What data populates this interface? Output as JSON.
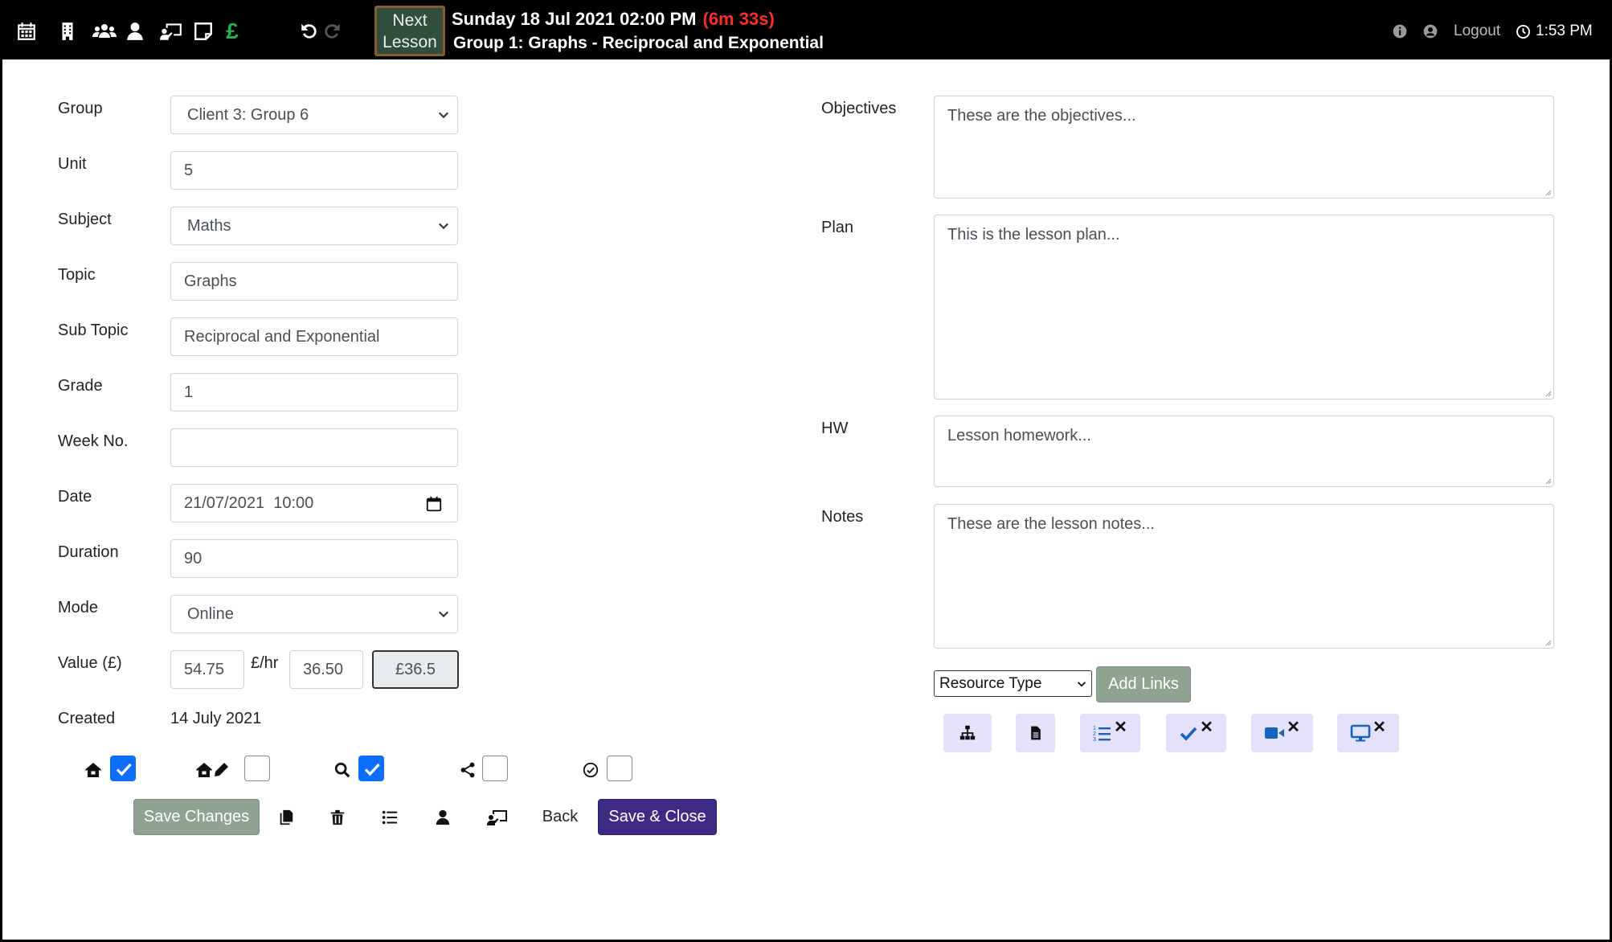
{
  "topbar": {
    "icons": [
      "calendar-icon",
      "building-icon",
      "users-icon",
      "user-icon",
      "chalkboard-teacher-icon",
      "sticky-note-icon",
      "pound-icon",
      "undo-icon",
      "redo-icon"
    ],
    "pound_symbol": "£",
    "next_lesson_label": "Next Lesson",
    "datetime": "Sunday 18 Jul 2021 02:00 PM",
    "countdown": "(6m 33s)",
    "lesson_title": "Group 1: Graphs - Reciprocal and Exponential",
    "logout_label": "Logout",
    "clock": "1:53 PM",
    "countdown_color": "#ff2a2a"
  },
  "form": {
    "group": {
      "label": "Group",
      "value": "Client 3: Group 6"
    },
    "unit": {
      "label": "Unit",
      "value": "5"
    },
    "subject": {
      "label": "Subject",
      "value": "Maths"
    },
    "topic": {
      "label": "Topic",
      "value": "Graphs"
    },
    "subtopic": {
      "label": "Sub Topic",
      "value": "Reciprocal and Exponential"
    },
    "grade": {
      "label": "Grade",
      "value": "1"
    },
    "week": {
      "label": "Week No.",
      "value": ""
    },
    "date": {
      "label": "Date",
      "value": "21/07/2021  10:00"
    },
    "duration": {
      "label": "Duration",
      "value": "90"
    },
    "mode": {
      "label": "Mode",
      "value": "Online"
    },
    "value": {
      "label": "Value (£)",
      "amount": "54.75",
      "rate_unit": "£/hr",
      "rate": "36.50",
      "total": "£36.5"
    },
    "created": {
      "label": "Created",
      "value": "14 July 2021"
    }
  },
  "flags": [
    {
      "icon": "home-icon",
      "checked": true
    },
    {
      "icon": "home-pen-icon",
      "checked": false
    },
    {
      "icon": "search-icon",
      "checked": true
    },
    {
      "icon": "share-icon",
      "checked": false
    },
    {
      "icon": "check-circle-icon",
      "checked": false
    }
  ],
  "actions": {
    "save_changes": "Save Changes",
    "back": "Back",
    "save_close": "Save & Close"
  },
  "right": {
    "objectives": {
      "label": "Objectives",
      "value": "These are the objectives..."
    },
    "plan": {
      "label": "Plan",
      "value": "This is the lesson plan..."
    },
    "hw": {
      "label": "HW",
      "value": "Lesson homework..."
    },
    "notes": {
      "label": "Notes",
      "value": "These are the lesson notes..."
    },
    "resource_type": "Resource Type",
    "add_links": "Add Links"
  },
  "colors": {
    "accent_purple": "#3d2b85",
    "gray_button": "#8fa392",
    "checkbox_blue": "#0d6efd",
    "resource_button_bg": "#e3e1fb",
    "resource_icon_blue": "#1565c0"
  }
}
